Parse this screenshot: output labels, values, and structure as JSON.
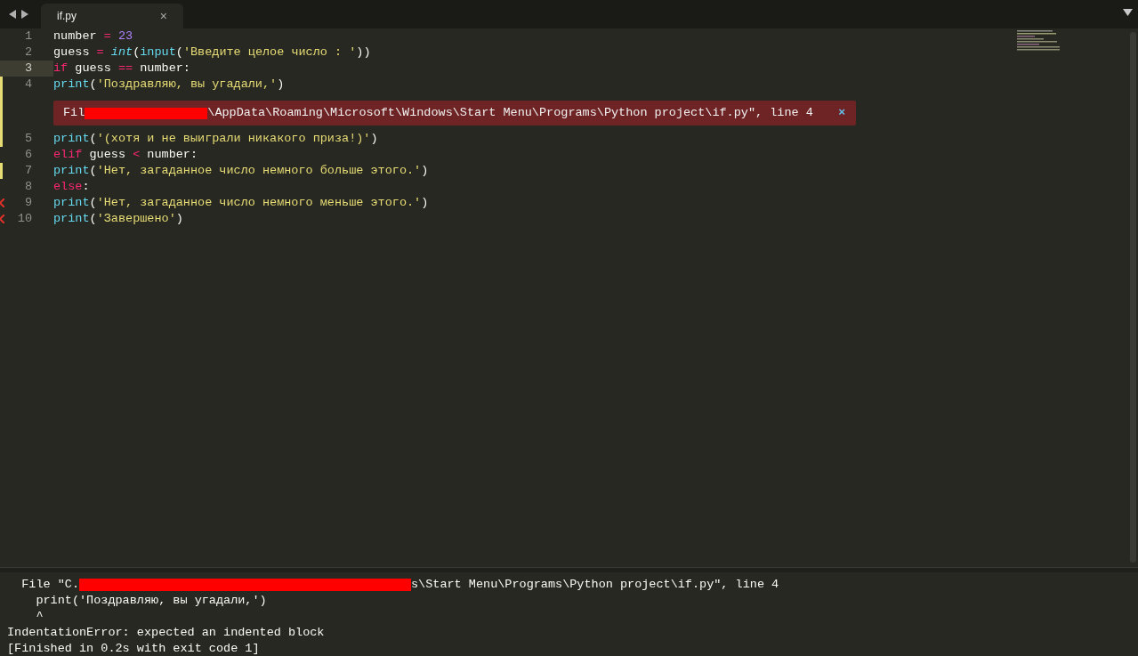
{
  "tabs": [
    {
      "label": "if.py",
      "selected": true,
      "close": "×"
    }
  ],
  "lines": [
    {
      "number": "1",
      "current": false,
      "modified": false,
      "error_mark": false,
      "tokens": [
        {
          "kind": "plain",
          "text": "number"
        },
        {
          "kind": "operator",
          "text": " = "
        },
        {
          "kind": "number",
          "text": "23"
        }
      ]
    },
    {
      "number": "2",
      "current": false,
      "modified": false,
      "error_mark": false,
      "tokens": [
        {
          "kind": "plain",
          "text": "guess"
        },
        {
          "kind": "operator",
          "text": " = "
        },
        {
          "kind": "type",
          "text": "int"
        },
        {
          "kind": "plain",
          "text": "("
        },
        {
          "kind": "function",
          "text": "input"
        },
        {
          "kind": "plain",
          "text": "("
        },
        {
          "kind": "string",
          "text": "'Введите целое число : '"
        },
        {
          "kind": "plain",
          "text": "))"
        }
      ]
    },
    {
      "number": "3",
      "current": true,
      "modified": false,
      "error_mark": false,
      "tokens": [
        {
          "kind": "keyword",
          "text": "if"
        },
        {
          "kind": "plain",
          "text": " guess "
        },
        {
          "kind": "operator",
          "text": "=="
        },
        {
          "kind": "plain",
          "text": " number:"
        }
      ]
    },
    {
      "number": "4",
      "current": false,
      "modified": true,
      "error_mark": false,
      "tokens": [
        {
          "kind": "function",
          "text": "print"
        },
        {
          "kind": "plain",
          "text": "("
        },
        {
          "kind": "string",
          "text": "'Поздравляю, вы угадали,'"
        },
        {
          "kind": "plain",
          "text": ")"
        }
      ],
      "error": {
        "before": "Fil",
        "after": "\\AppData\\Roaming\\Microsoft\\Windows\\Start Menu\\Programs\\Python project\\if.py\", line 4",
        "close": "×"
      }
    },
    {
      "number": "5",
      "current": false,
      "modified": true,
      "error_mark": false,
      "tokens": [
        {
          "kind": "function",
          "text": "print"
        },
        {
          "kind": "plain",
          "text": "("
        },
        {
          "kind": "string",
          "text": "'(хотя и не выиграли никакого приза!)'"
        },
        {
          "kind": "plain",
          "text": ")"
        }
      ]
    },
    {
      "number": "6",
      "current": false,
      "modified": false,
      "error_mark": false,
      "tokens": [
        {
          "kind": "keyword",
          "text": "elif"
        },
        {
          "kind": "plain",
          "text": " guess "
        },
        {
          "kind": "operator",
          "text": "<"
        },
        {
          "kind": "plain",
          "text": " number:"
        }
      ]
    },
    {
      "number": "7",
      "current": false,
      "modified": true,
      "error_mark": false,
      "tokens": [
        {
          "kind": "function",
          "text": "print"
        },
        {
          "kind": "plain",
          "text": "("
        },
        {
          "kind": "string",
          "text": "'Нет, загаданное число немного больше этого.'"
        },
        {
          "kind": "plain",
          "text": ")"
        }
      ]
    },
    {
      "number": "8",
      "current": false,
      "modified": false,
      "error_mark": false,
      "tokens": [
        {
          "kind": "keyword",
          "text": "else"
        },
        {
          "kind": "plain",
          "text": ":"
        }
      ]
    },
    {
      "number": "9",
      "current": false,
      "modified": false,
      "error_mark": true,
      "tokens": [
        {
          "kind": "function",
          "text": "print"
        },
        {
          "kind": "plain",
          "text": "("
        },
        {
          "kind": "string",
          "text": "'Нет, загаданное число немного меньше этого.'"
        },
        {
          "kind": "plain",
          "text": ")"
        }
      ]
    },
    {
      "number": "10",
      "current": false,
      "modified": false,
      "error_mark": true,
      "tokens": [
        {
          "kind": "function",
          "text": "print"
        },
        {
          "kind": "plain",
          "text": "("
        },
        {
          "kind": "string",
          "text": "'Завершено'"
        },
        {
          "kind": "plain",
          "text": ")"
        }
      ]
    }
  ],
  "output": [
    {
      "kind": "redacted",
      "before": "  File \"C.",
      "after": "s\\Start Menu\\Programs\\Python project\\if.py\", line 4"
    },
    {
      "kind": "text",
      "text": "    print('Поздравляю, вы угадали,')"
    },
    {
      "kind": "text",
      "text": "    ^"
    },
    {
      "kind": "text",
      "text": "IndentationError: expected an indented block"
    },
    {
      "kind": "text",
      "text": "[Finished in 0.2s with exit code 1]"
    }
  ]
}
